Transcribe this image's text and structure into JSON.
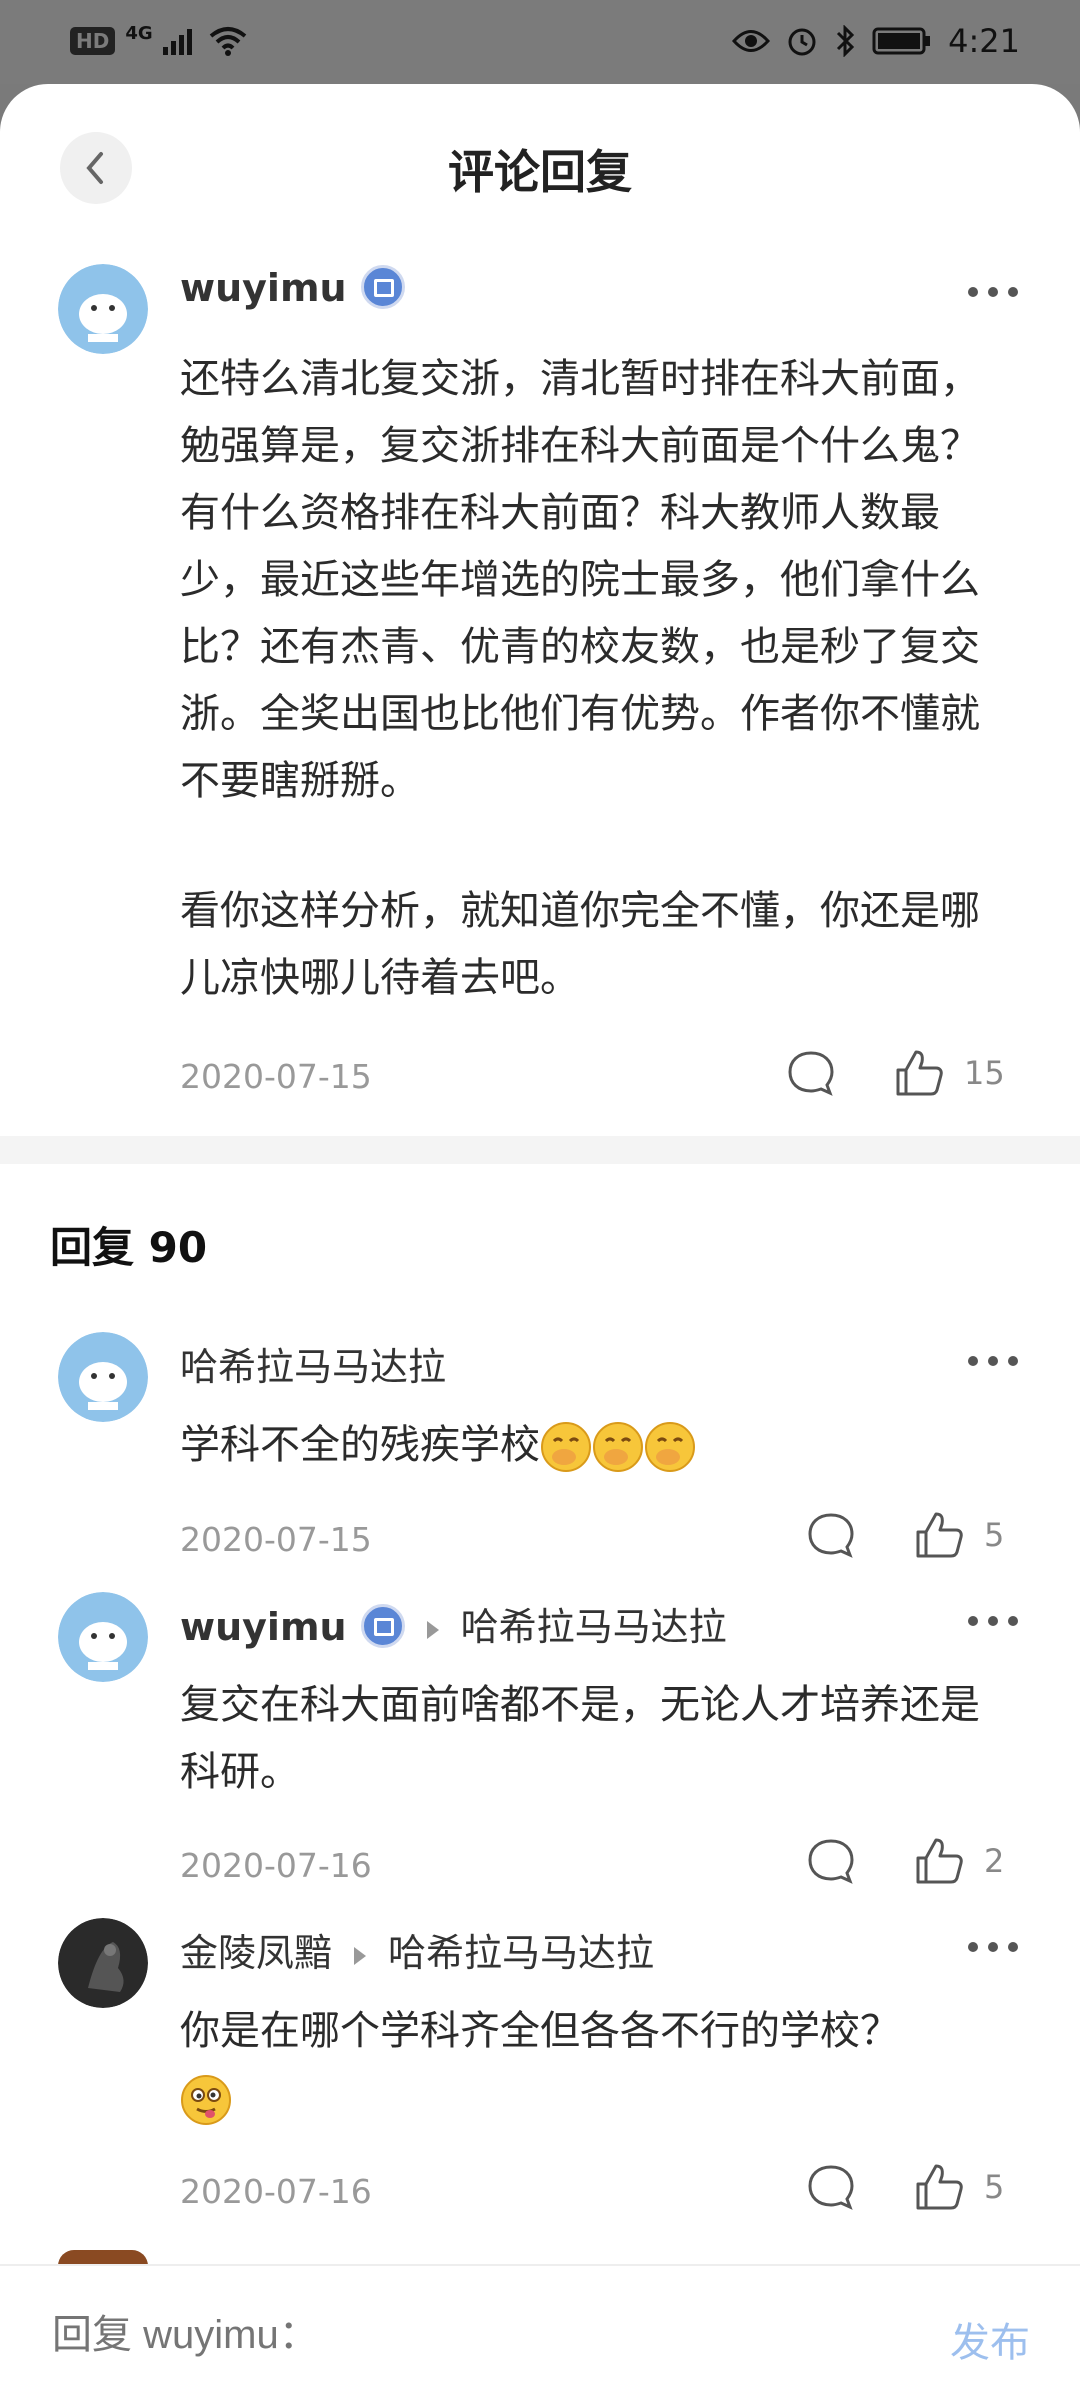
{
  "status_bar": {
    "hd": "HD",
    "network": "4G",
    "time": "4:21"
  },
  "header": {
    "title": "评论回复"
  },
  "main_comment": {
    "author": "wuyimu",
    "paragraph1": "还特么清北复交浙，清北暂时排在科大前面，勉强算是，复交浙排在科大前面是个什么鬼？有什么资格排在科大前面？科大教师人数最少，最近这些年增选的院士最多，他们拿什么比？还有杰青、优青的校友数，也是秒了复交浙。全奖出国也比他们有优势。作者你不懂就不要瞎掰掰。",
    "paragraph2": "看你这样分析，就知道你完全不懂，你还是哪儿凉快哪儿待着去吧。",
    "date": "2020-07-15",
    "likes": "15"
  },
  "replies_header": {
    "label": "回复 90"
  },
  "replies": [
    {
      "author": "哈希拉马马达拉",
      "text": "学科不全的残疾学校",
      "date": "2020-07-15",
      "likes": "5"
    },
    {
      "author": "wuyimu",
      "reply_to": "哈希拉马马达拉",
      "text": "复交在科大面前啥都不是，无论人才培养还是科研。",
      "date": "2020-07-16",
      "likes": "2"
    },
    {
      "author": "金陵凤黯",
      "reply_to": "哈希拉马马达拉",
      "text": "你是在哪个学科齐全但各各不行的学校？",
      "date": "2020-07-16",
      "likes": "5"
    }
  ],
  "bottom_bar": {
    "placeholder": "回复 wuyimu：",
    "publish_label": "发布"
  },
  "colors": {
    "accent": "#9dbfee",
    "badge": "#5a86d6"
  }
}
